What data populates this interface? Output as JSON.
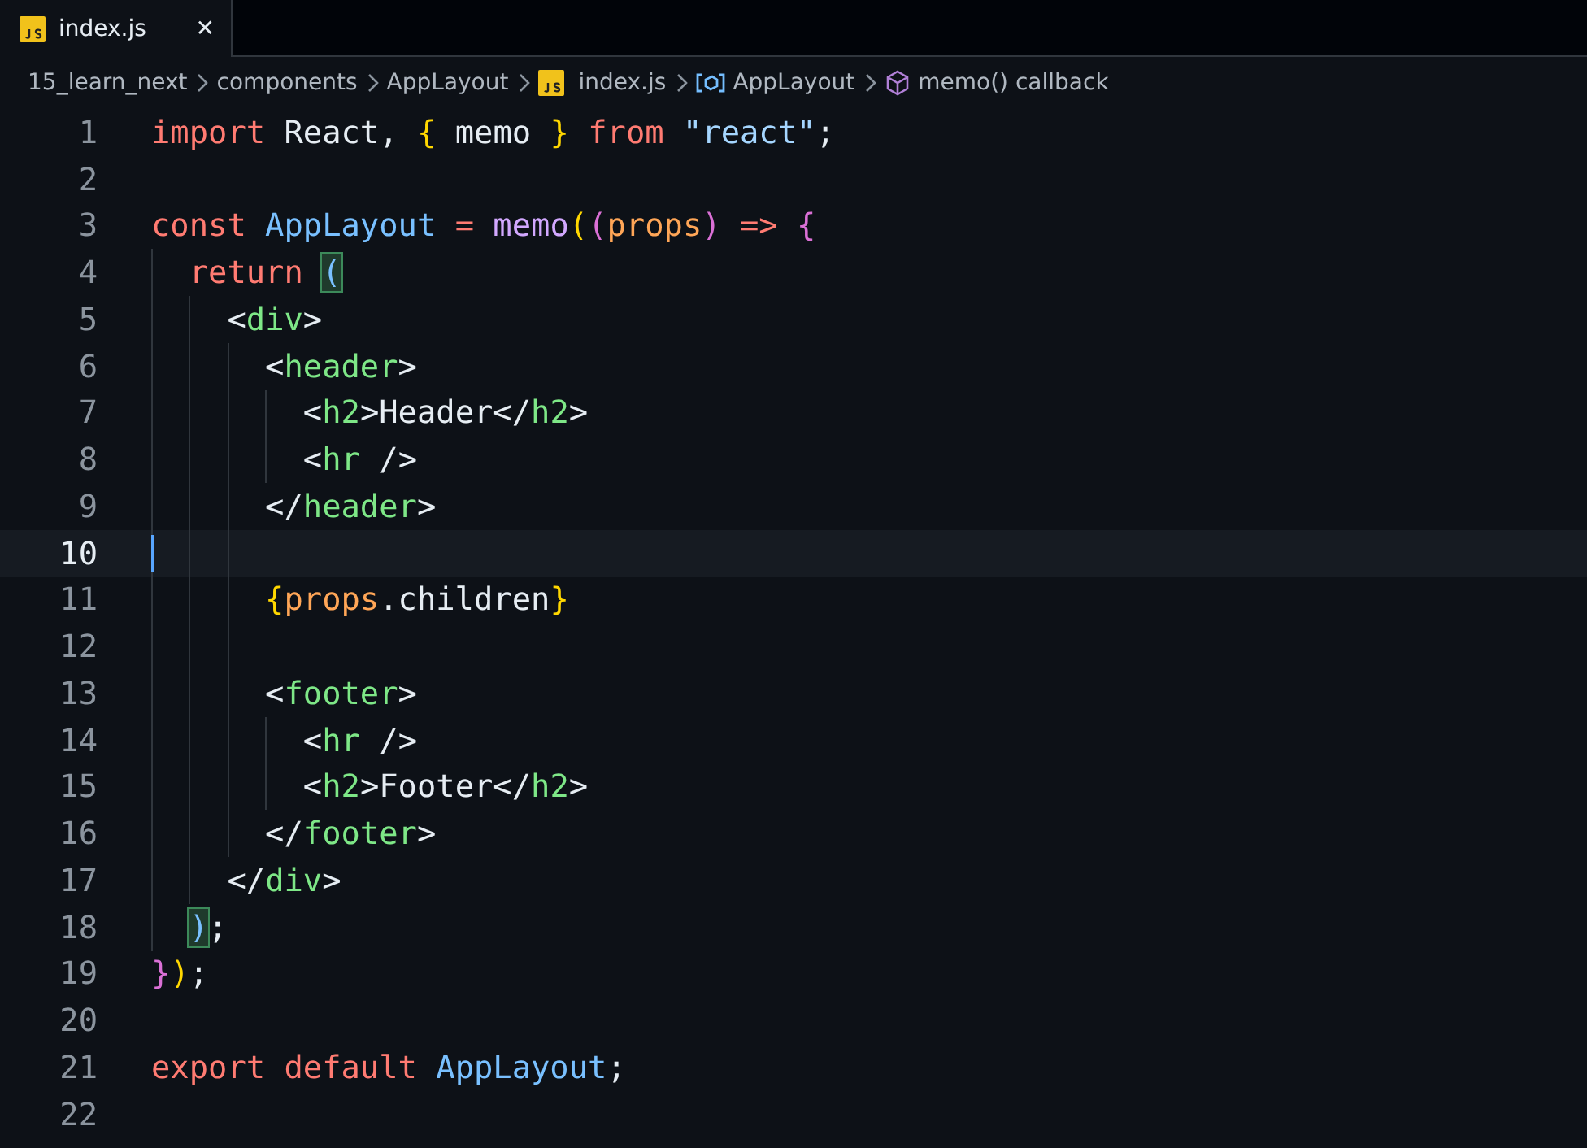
{
  "tab": {
    "label": "index.js",
    "close": "✕"
  },
  "breadcrumbs": [
    {
      "text": "15_learn_next",
      "kind": "folder"
    },
    {
      "text": "components",
      "kind": "folder"
    },
    {
      "text": "AppLayout",
      "kind": "folder"
    },
    {
      "text": "index.js",
      "kind": "file"
    },
    {
      "text": "AppLayout",
      "kind": "variable"
    },
    {
      "text": "memo() callback",
      "kind": "function"
    }
  ],
  "lines": [
    {
      "number": "1",
      "current": false,
      "tokens": [
        {
          "text": "import ",
          "kind": "keyword"
        },
        {
          "text": "React, ",
          "kind": "plain"
        },
        {
          "text": "{",
          "kind": "brace1"
        },
        {
          "text": " memo ",
          "kind": "plain"
        },
        {
          "text": "}",
          "kind": "brace1"
        },
        {
          "text": " from ",
          "kind": "keyword"
        },
        {
          "text": "\"react\"",
          "kind": "string"
        },
        {
          "text": ";",
          "kind": "plain"
        }
      ]
    },
    {
      "number": "2",
      "current": false
    },
    {
      "number": "3",
      "current": false,
      "tokens": [
        {
          "text": "const ",
          "kind": "keyword"
        },
        {
          "text": "AppLayout",
          "kind": "identifier"
        },
        {
          "text": " = ",
          "kind": "keyword"
        },
        {
          "text": "memo",
          "kind": "function"
        },
        {
          "text": "(",
          "kind": "brace1"
        },
        {
          "text": "(",
          "kind": "brace2"
        },
        {
          "text": "props",
          "kind": "param"
        },
        {
          "text": ")",
          "kind": "brace2"
        },
        {
          "text": " => ",
          "kind": "keyword"
        },
        {
          "text": "{",
          "kind": "brace2"
        }
      ]
    },
    {
      "number": "4",
      "current": false,
      "tokens": [
        {
          "text": "  return ",
          "kind": "keyword"
        },
        {
          "text": "(",
          "kind": "bracket-match"
        }
      ]
    },
    {
      "number": "5",
      "current": false,
      "tokens": [
        {
          "text": "    <",
          "kind": "plain"
        },
        {
          "text": "div",
          "kind": "tag"
        },
        {
          "text": ">",
          "kind": "plain"
        }
      ]
    },
    {
      "number": "6",
      "current": false,
      "tokens": [
        {
          "text": "      <",
          "kind": "plain"
        },
        {
          "text": "header",
          "kind": "tag"
        },
        {
          "text": ">",
          "kind": "plain"
        }
      ]
    },
    {
      "number": "7",
      "current": false,
      "tokens": [
        {
          "text": "        <",
          "kind": "plain"
        },
        {
          "text": "h2",
          "kind": "tag"
        },
        {
          "text": ">Header</",
          "kind": "plain"
        },
        {
          "text": "h2",
          "kind": "tag"
        },
        {
          "text": ">",
          "kind": "plain"
        }
      ]
    },
    {
      "number": "8",
      "current": false,
      "tokens": [
        {
          "text": "        <",
          "kind": "plain"
        },
        {
          "text": "hr",
          "kind": "tag"
        },
        {
          "text": " />",
          "kind": "plain"
        }
      ]
    },
    {
      "number": "9",
      "current": false,
      "tokens": [
        {
          "text": "      </",
          "kind": "plain"
        },
        {
          "text": "header",
          "kind": "tag"
        },
        {
          "text": ">",
          "kind": "plain"
        }
      ]
    },
    {
      "number": "10",
      "current": true
    },
    {
      "number": "11",
      "current": false,
      "tokens": [
        {
          "text": "      {",
          "kind": "brace1"
        },
        {
          "text": "props",
          "kind": "param"
        },
        {
          "text": ".children",
          "kind": "plain"
        },
        {
          "text": "}",
          "kind": "brace1"
        }
      ]
    },
    {
      "number": "12",
      "current": false
    },
    {
      "number": "13",
      "current": false,
      "tokens": [
        {
          "text": "      <",
          "kind": "plain"
        },
        {
          "text": "footer",
          "kind": "tag"
        },
        {
          "text": ">",
          "kind": "plain"
        }
      ]
    },
    {
      "number": "14",
      "current": false,
      "tokens": [
        {
          "text": "        <",
          "kind": "plain"
        },
        {
          "text": "hr",
          "kind": "tag"
        },
        {
          "text": " />",
          "kind": "plain"
        }
      ]
    },
    {
      "number": "15",
      "current": false,
      "tokens": [
        {
          "text": "        <",
          "kind": "plain"
        },
        {
          "text": "h2",
          "kind": "tag"
        },
        {
          "text": ">Footer</",
          "kind": "plain"
        },
        {
          "text": "h2",
          "kind": "tag"
        },
        {
          "text": ">",
          "kind": "plain"
        }
      ]
    },
    {
      "number": "16",
      "current": false,
      "tokens": [
        {
          "text": "      </",
          "kind": "plain"
        },
        {
          "text": "footer",
          "kind": "tag"
        },
        {
          "text": ">",
          "kind": "plain"
        }
      ]
    },
    {
      "number": "17",
      "current": false,
      "tokens": [
        {
          "text": "    </",
          "kind": "plain"
        },
        {
          "text": "div",
          "kind": "tag"
        },
        {
          "text": ">",
          "kind": "plain"
        }
      ]
    },
    {
      "number": "18",
      "current": false,
      "tokens": [
        {
          "text": "  )",
          "kind": "bracket-match"
        },
        {
          "text": ";",
          "kind": "plain"
        }
      ]
    },
    {
      "number": "19",
      "current": false,
      "tokens": [
        {
          "text": "}",
          "kind": "brace2"
        },
        {
          "text": ")",
          "kind": "brace1"
        },
        {
          "text": ";",
          "kind": "plain"
        }
      ]
    },
    {
      "number": "20",
      "current": false
    },
    {
      "number": "21",
      "current": false,
      "tokens": [
        {
          "text": "export ",
          "kind": "keyword"
        },
        {
          "text": "default ",
          "kind": "keyword"
        },
        {
          "text": "AppLayout",
          "kind": "identifier"
        },
        {
          "text": ";",
          "kind": "plain"
        }
      ]
    },
    {
      "number": "22",
      "current": false
    }
  ]
}
